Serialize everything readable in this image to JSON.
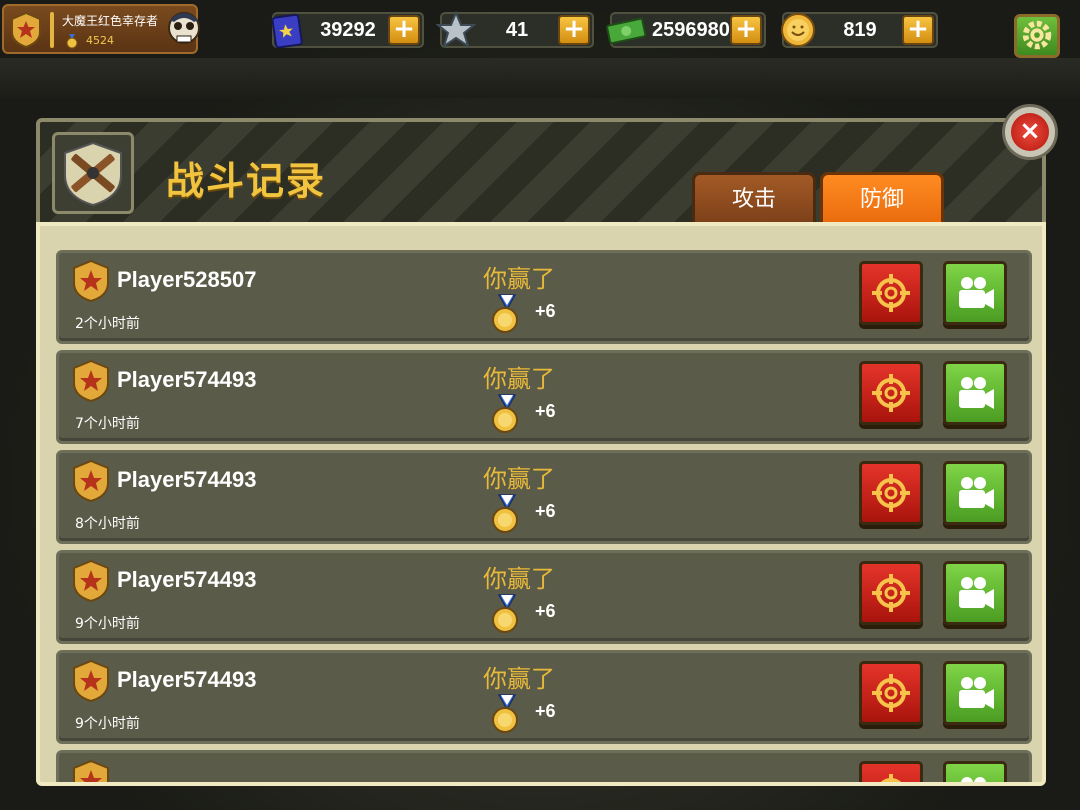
{
  "topbar": {
    "player_name": "大魔王红色幸存者",
    "player_score": "4524",
    "resources": [
      {
        "name": "book",
        "value": "39292",
        "icon": "book-icon"
      },
      {
        "name": "star",
        "value": "41",
        "icon": "star-icon"
      },
      {
        "name": "cash",
        "value": "2596980",
        "icon": "cash-icon"
      },
      {
        "name": "coin",
        "value": "819",
        "icon": "coin-icon"
      }
    ],
    "plus_label": "+",
    "settings_icon": "gear-icon"
  },
  "panel": {
    "title": "战斗记录",
    "tabs": [
      {
        "label": "攻击",
        "active": false
      },
      {
        "label": "防御",
        "active": true
      }
    ],
    "close_label": "×"
  },
  "records": [
    {
      "player": "Player528507",
      "time": "2个小时前",
      "result": "你赢了",
      "delta": "+6"
    },
    {
      "player": "Player574493",
      "time": "7个小时前",
      "result": "你赢了",
      "delta": "+6"
    },
    {
      "player": "Player574493",
      "time": "8个小时前",
      "result": "你赢了",
      "delta": "+6"
    },
    {
      "player": "Player574493",
      "time": "9个小时前",
      "result": "你赢了",
      "delta": "+6"
    },
    {
      "player": "Player574493",
      "time": "9个小时前",
      "result": "你赢了",
      "delta": "+6"
    },
    {
      "player": "",
      "time": "",
      "result": "",
      "delta": ""
    }
  ],
  "colors": {
    "accent_gold": "#f2c33e",
    "win_text": "#e9b93a",
    "attack_button": "#d1261c",
    "replay_button": "#6cc238",
    "active_tab": "#f57b16"
  }
}
